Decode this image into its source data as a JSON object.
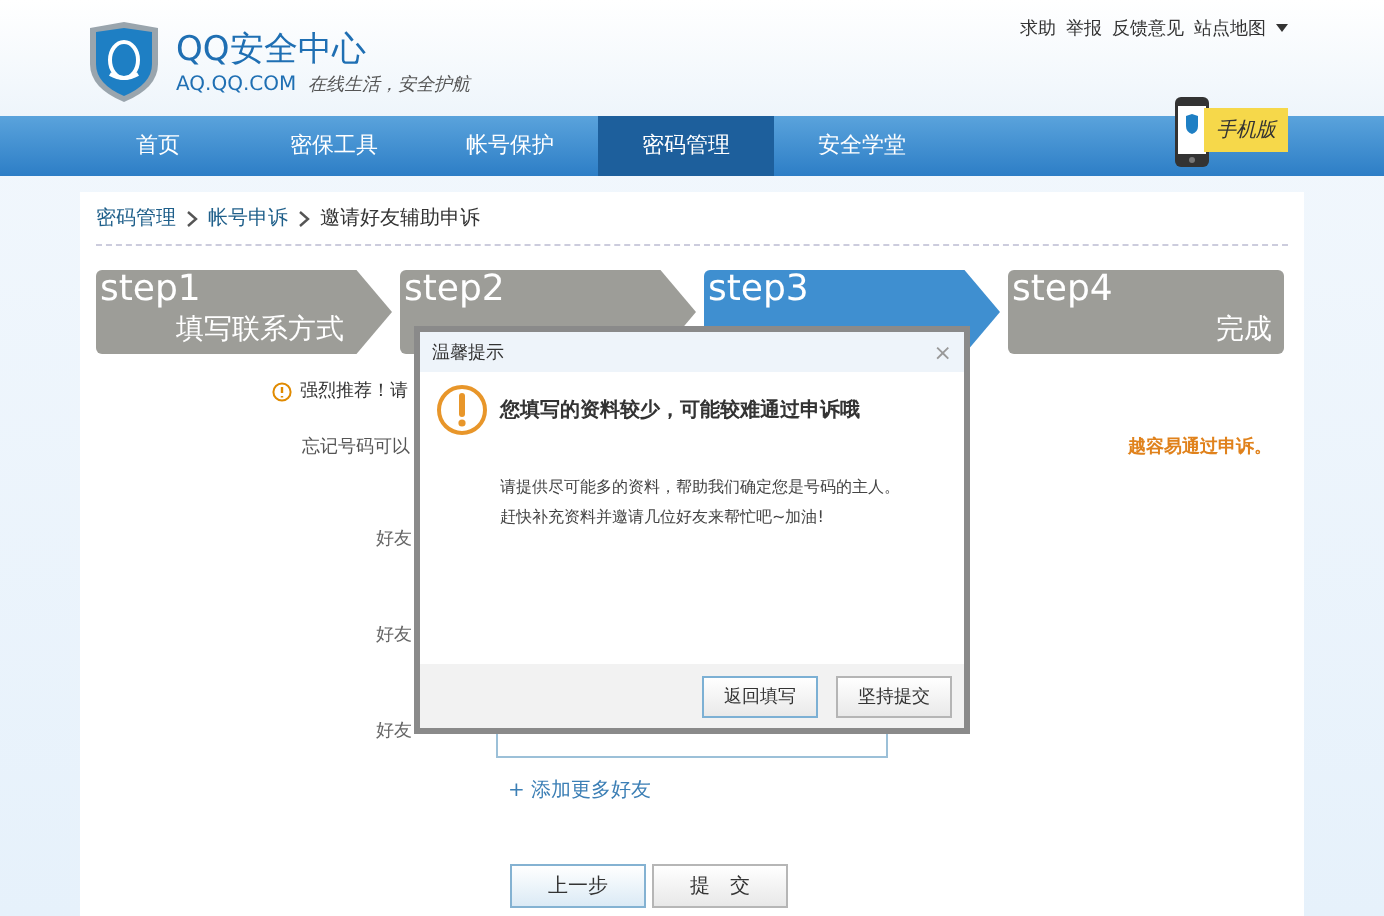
{
  "header": {
    "logo_title": "QQ安全中心",
    "logo_domain": "AQ.QQ.COM",
    "slogan": "在线生活，安全护航",
    "links": [
      "求助",
      "举报",
      "反馈意见",
      "站点地图"
    ]
  },
  "nav": {
    "tabs": [
      {
        "label": "首页",
        "selected": false
      },
      {
        "label": "密保工具",
        "selected": false
      },
      {
        "label": "帐号保护",
        "selected": false
      },
      {
        "label": "密码管理",
        "selected": true
      },
      {
        "label": "安全学堂",
        "selected": false
      }
    ],
    "mobile_badge": "手机版"
  },
  "breadcrumb": [
    "密码管理",
    "帐号申诉",
    "邀请好友辅助申诉"
  ],
  "steps": [
    {
      "label": "step1",
      "title": "填写联系方式",
      "selected": false
    },
    {
      "label": "step2",
      "selected": false
    },
    {
      "label": "step3",
      "selected": true
    },
    {
      "label": "step4",
      "title": "完成",
      "selected": false
    }
  ],
  "form": {
    "notice": "强烈推荐！请",
    "hint": "忘记号码可以",
    "hint_emphasis": "越容易通过申诉。",
    "friend_rows": [
      {
        "label": "好友"
      },
      {
        "label": "好友"
      },
      {
        "label": "好友"
      }
    ],
    "add_friend": "+ 添加更多好友",
    "buttons": [
      "上一步",
      "提　交"
    ]
  },
  "dialog": {
    "title": "温馨提示",
    "close": "×",
    "heading": "您填写的资料较少，可能较难通过申诉哦",
    "body": [
      "请提供尽可能多的资料，帮助我们确定您是号码的主人。",
      "赶快补充资料并邀请几位好友来帮忙吧~加油!"
    ],
    "buttons": [
      "返回填写",
      "坚持提交"
    ]
  }
}
